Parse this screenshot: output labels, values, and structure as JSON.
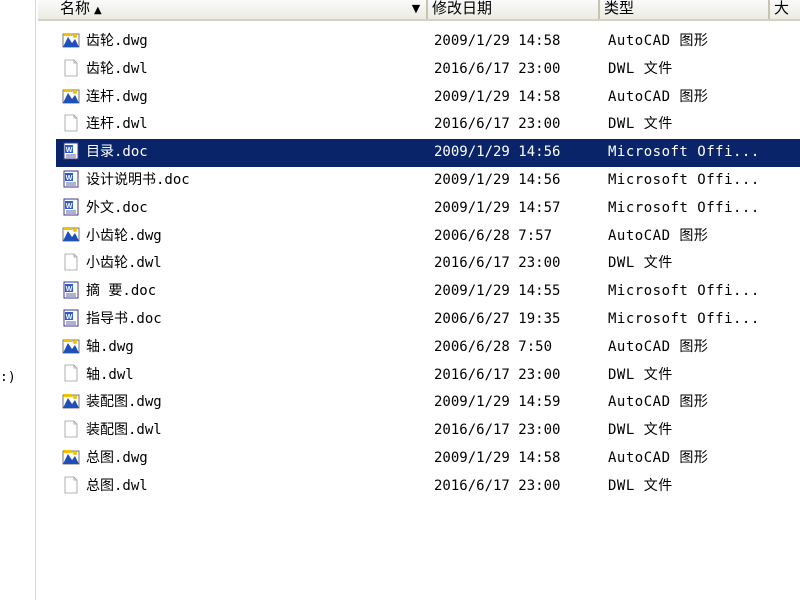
{
  "header": {
    "name": "名称",
    "date": "修改日期",
    "type": "类型",
    "size": "大"
  },
  "left_fragment": ":)",
  "files": [
    {
      "name": "齿轮.dwg",
      "date": "2009/1/29 14:58",
      "type": "AutoCAD 图形",
      "icon": "autocad-dwg-icon"
    },
    {
      "name": "齿轮.dwl",
      "date": "2016/6/17 23:00",
      "type": "DWL 文件",
      "icon": "blank-file-icon"
    },
    {
      "name": "连杆.dwg",
      "date": "2009/1/29 14:58",
      "type": "AutoCAD 图形",
      "icon": "autocad-dwg-icon"
    },
    {
      "name": "连杆.dwl",
      "date": "2016/6/17 23:00",
      "type": "DWL 文件",
      "icon": "blank-file-icon"
    },
    {
      "name": "目录.doc",
      "date": "2009/1/29 14:56",
      "type": "Microsoft Offi...",
      "icon": "word-doc-icon",
      "selected": true
    },
    {
      "name": "设计说明书.doc",
      "date": "2009/1/29 14:56",
      "type": "Microsoft Offi...",
      "icon": "word-doc-icon"
    },
    {
      "name": "外文.doc",
      "date": "2009/1/29 14:57",
      "type": "Microsoft Offi...",
      "icon": "word-doc-icon"
    },
    {
      "name": "小齿轮.dwg",
      "date": "2006/6/28 7:57",
      "type": "AutoCAD 图形",
      "icon": "autocad-dwg-icon"
    },
    {
      "name": "小齿轮.dwl",
      "date": "2016/6/17 23:00",
      "type": "DWL 文件",
      "icon": "blank-file-icon"
    },
    {
      "name": "摘 要.doc",
      "date": "2009/1/29 14:55",
      "type": "Microsoft Offi...",
      "icon": "word-doc-icon"
    },
    {
      "name": "指导书.doc",
      "date": "2006/6/27 19:35",
      "type": "Microsoft Offi...",
      "icon": "word-doc-icon"
    },
    {
      "name": "轴.dwg",
      "date": "2006/6/28 7:50",
      "type": "AutoCAD 图形",
      "icon": "autocad-dwg-icon"
    },
    {
      "name": "轴.dwl",
      "date": "2016/6/17 23:00",
      "type": "DWL 文件",
      "icon": "blank-file-icon"
    },
    {
      "name": "装配图.dwg",
      "date": "2009/1/29 14:59",
      "type": "AutoCAD 图形",
      "icon": "autocad-dwg-icon"
    },
    {
      "name": "装配图.dwl",
      "date": "2016/6/17 23:00",
      "type": "DWL 文件",
      "icon": "blank-file-icon"
    },
    {
      "name": "总图.dwg",
      "date": "2009/1/29 14:58",
      "type": "AutoCAD 图形",
      "icon": "autocad-dwg-icon"
    },
    {
      "name": "总图.dwl",
      "date": "2016/6/17 23:00",
      "type": "DWL 文件",
      "icon": "blank-file-icon"
    }
  ],
  "colors": {
    "selection": "#0a246a",
    "dwg_yellow": "#f2c200",
    "dwg_blue": "#1f4fb8",
    "word_blue": "#2a5bd7"
  }
}
